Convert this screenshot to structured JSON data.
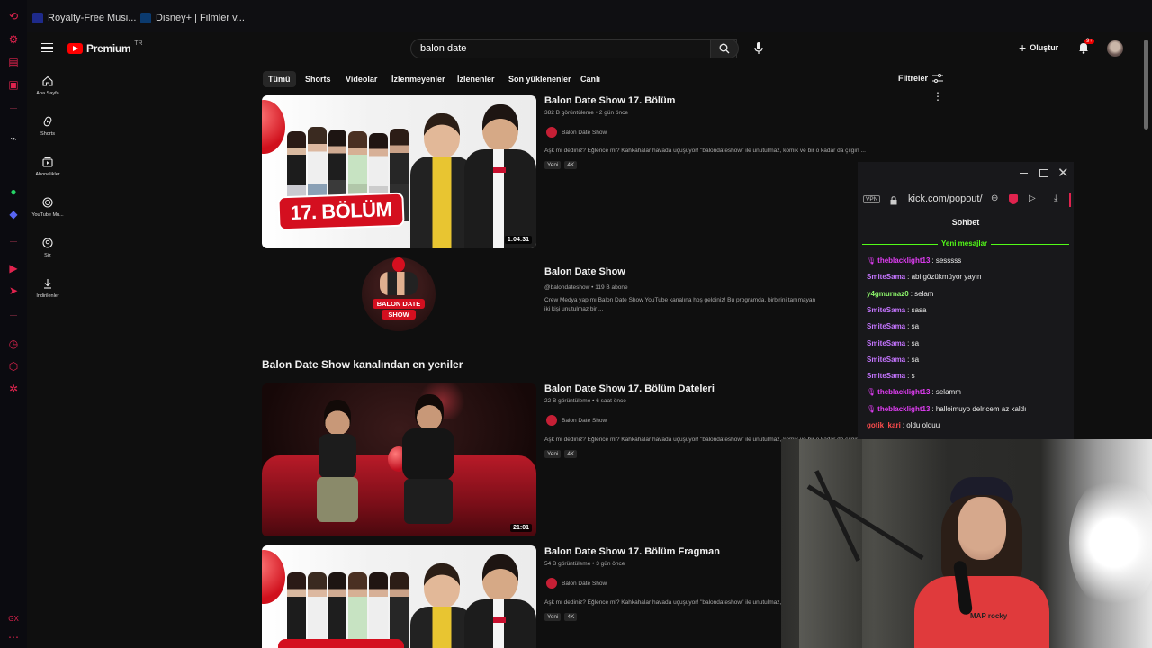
{
  "browser": {
    "bookmarks": [
      {
        "label": "Royalty-Free Musi...",
        "icon": "music-favicon-icon"
      },
      {
        "label": "Disney+ | Filmler v...",
        "icon": "disney-favicon-icon"
      }
    ]
  },
  "header": {
    "brand": "Premium",
    "region": "TR",
    "search_value": "balon date",
    "create_label": "Oluştur",
    "notif_badge": "9+"
  },
  "nav": [
    {
      "label": "Ana Sayfa",
      "icon": "home-icon"
    },
    {
      "label": "Shorts",
      "icon": "shorts-icon"
    },
    {
      "label": "Abonelikler",
      "icon": "subscriptions-icon"
    },
    {
      "label": "YouTube Mu...",
      "icon": "youtube-music-icon"
    },
    {
      "label": "Siz",
      "icon": "you-icon"
    },
    {
      "label": "İndirilenler",
      "icon": "download-icon"
    }
  ],
  "chips": [
    "Tümü",
    "Shorts",
    "Videolar",
    "İzlenmeyenler",
    "İzlenenler",
    "Son yüklenenler",
    "Canlı"
  ],
  "filters_label": "Filtreler",
  "results": {
    "video1": {
      "title": "Balon Date Show 17. Bölüm",
      "meta": "382 B görüntüleme • 2 gün önce",
      "channel": "Balon Date Show",
      "desc": "Aşk mı dediniz? Eğlence mi? Kahkahalar havada uçuşuyor! \"balondateshow\" ile unutulmaz, komik ve bir o kadar da çılgın ...",
      "badge1": "Yeni",
      "badge2": "4K",
      "duration": "1:04:31",
      "thumb_text": "17. BÖLÜM"
    },
    "channel": {
      "name": "Balon Date Show",
      "handle": "@balondateshow • 119 B abone",
      "desc1": "Crew Medya yapımı Balon Date Show YouTube kanalına hoş geldiniz! Bu programda, birbirini tanımayan",
      "desc2": "iki kişi unutulmaz bir ...",
      "logo_text1": "BALON DATE",
      "logo_text2": "SHOW"
    },
    "section_title": "Balon Date Show kanalından en yeniler",
    "video2": {
      "title": "Balon Date Show 17. Bölüm Dateleri",
      "meta": "22 B görüntüleme • 6 saat önce",
      "channel": "Balon Date Show",
      "desc": "Aşk mı dediniz? Eğlence mi? Kahkahalar havada uçuşuyor! \"balondateshow\" ile unutulmaz, komik ve bir o kadar da çılgın ...",
      "badge1": "Yeni",
      "badge2": "4K",
      "duration": "21:01"
    },
    "video3": {
      "title": "Balon Date Show 17. Bölüm Fragman",
      "meta": "54 B görüntüleme • 3 gün önce",
      "channel": "Balon Date Show",
      "desc": "Aşk mı dediniz? Eğlence mi? Kahkahalar havada uçuşuyor! \"balondateshow\" ile unutulmaz, komik ve bir o kadar da çılgın ...",
      "badge1": "Yeni",
      "badge2": "4K"
    }
  },
  "kick": {
    "vpn": "VPN",
    "url": "kick.com/popout/",
    "title": "Sohbet",
    "new_messages": "Yeni mesajlar",
    "messages": [
      {
        "user": "theblacklight13",
        "text": ": sesssss",
        "color": "#e23df5",
        "icon": true
      },
      {
        "user": "SmiteSama",
        "text": ": abi gözükmüyor yayın",
        "color": "#c575ff",
        "icon": false
      },
      {
        "user": "y4gmurnaz0",
        "text": ": selam",
        "color": "#8df56b",
        "icon": false
      },
      {
        "user": "SmiteSama",
        "text": ": sasa",
        "color": "#c575ff",
        "icon": false
      },
      {
        "user": "SmiteSama",
        "text": ": sa",
        "color": "#c575ff",
        "icon": false
      },
      {
        "user": "SmiteSama",
        "text": ": sa",
        "color": "#c575ff",
        "icon": false
      },
      {
        "user": "SmiteSama",
        "text": ": sa",
        "color": "#c575ff",
        "icon": false
      },
      {
        "user": "SmiteSama",
        "text": ": s",
        "color": "#c575ff",
        "icon": false
      },
      {
        "user": "theblacklight13",
        "text": ": selamm",
        "color": "#e23df5",
        "icon": true
      },
      {
        "user": "theblacklight13",
        "text": ": halloimuyo delricem az kaldı",
        "color": "#e23df5",
        "icon": true
      },
      {
        "user": "gotik_kari",
        "text": ": oldu olduu",
        "color": "#ff4d4d",
        "icon": false
      }
    ]
  },
  "webcam": {
    "shirt_text": "MAP rocky"
  },
  "colors": {
    "accent": "#ff0000",
    "gx": "#e0234e",
    "kick_green": "#53fc18"
  }
}
